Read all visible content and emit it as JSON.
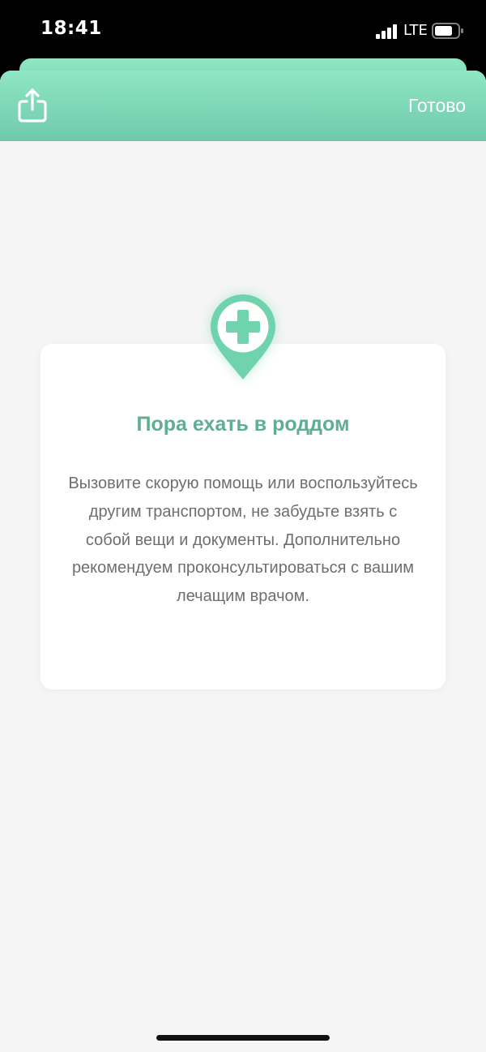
{
  "status_bar": {
    "time": "18:41",
    "network": "LTE",
    "icons": [
      "signal-bars-icon",
      "battery-icon"
    ]
  },
  "nav": {
    "share_icon": "share-icon",
    "done_label": "Готово"
  },
  "card": {
    "icon": "medical-location-pin-icon",
    "title": "Пора ехать в роддом",
    "body": "Вызовите скорую помощь или воспользуйтесь другим транспортом, не забудьте взять с собой вещи и документы. Дополнительно рекомендуем проконсультироваться с вашим лечащим врачом."
  },
  "colors": {
    "accent_green": "#5eaf8f",
    "nav_gradient_top": "#8ee6c4",
    "nav_gradient_bottom": "#70c9ac",
    "pin_color": "#6fd3ad",
    "background": "#f5f5f5",
    "body_text": "#6e6e73"
  }
}
